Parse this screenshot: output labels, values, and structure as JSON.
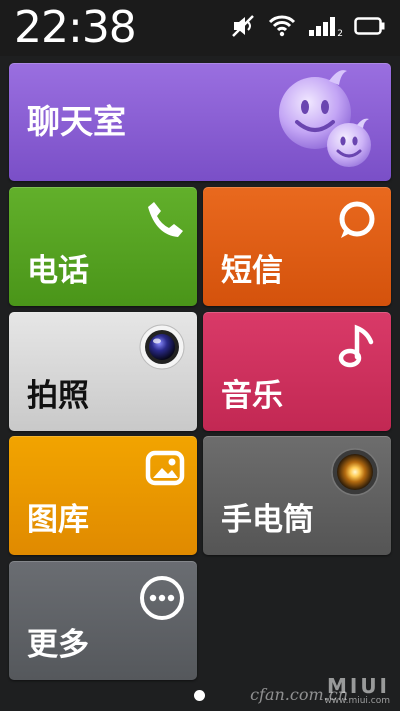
{
  "statusbar": {
    "time": "22:38",
    "icons": [
      "mute-icon",
      "wifi-icon",
      "signal-icon",
      "battery-icon"
    ],
    "signal_sub": "2"
  },
  "tiles": {
    "chatroom": {
      "label": "聊天室",
      "icon": "smiley-icon",
      "color": "#8a5ed6"
    },
    "phone": {
      "label": "电话",
      "icon": "phone-icon",
      "color": "#56a323"
    },
    "sms": {
      "label": "短信",
      "icon": "chat-bubble-icon",
      "color": "#de5e14"
    },
    "camera": {
      "label": "拍照",
      "icon": "camera-lens-icon",
      "color": "#d8d8d8"
    },
    "music": {
      "label": "音乐",
      "icon": "music-note-icon",
      "color": "#cf315e"
    },
    "gallery": {
      "label": "图库",
      "icon": "picture-icon",
      "color": "#ea9700"
    },
    "flash": {
      "label": "手电筒",
      "icon": "flashlight-icon",
      "color": "#616161"
    },
    "more": {
      "label": "更多",
      "icon": "more-dots-icon",
      "color": "#606368"
    }
  },
  "pager": {
    "current": 1,
    "total": 1
  },
  "watermark": {
    "site": "cfan.com.cn",
    "brand": "MIUI",
    "url": "www.miui.com"
  }
}
